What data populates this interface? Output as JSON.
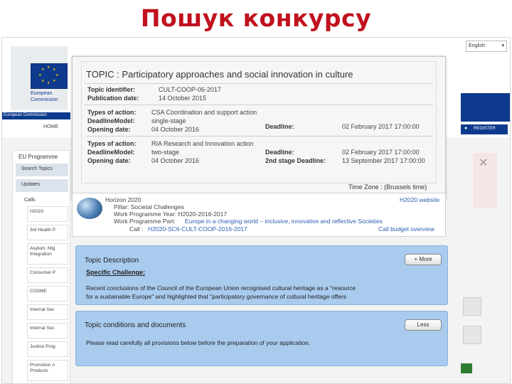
{
  "slide_title": "Пошук конкурсу",
  "portal": {
    "org_name_1": "European",
    "org_name_2": "Commission",
    "bar_text": "European Commission",
    "home": "HOME",
    "language": "English",
    "register": "REGISTER"
  },
  "sidebar": {
    "title": "EU Programme",
    "items": [
      "Search Topics",
      "Updates"
    ],
    "calls_label": "Calls",
    "programmes": [
      "H2020",
      "3rd Health P",
      "Asylum, Mig",
      "Integration",
      "Consumer P",
      "COSME",
      "Internal Sec",
      "Internal Sec",
      "Justice Prog",
      "Promotion o",
      "Products"
    ]
  },
  "topic": {
    "heading": "TOPIC : Participatory approaches and social innovation in culture",
    "identifier_label": "Topic identifier:",
    "identifier": "CULT-COOP-06-2017",
    "pubdate_label": "Publication date:",
    "pubdate": "14 October 2015",
    "block1": {
      "type_label": "Types of action:",
      "type": "CSA Coordination and support action",
      "model_label": "DeadlineModel:",
      "model": "single-stage",
      "opening_label": "Opening date:",
      "opening": "04 October 2016",
      "deadline_label": "Deadline:",
      "deadline": "02 February 2017 17:00:00"
    },
    "block2": {
      "type_label": "Types of action:",
      "type": "RIA Research and Innovation action",
      "model_label": "DeadlineModel:",
      "model": "two-stage",
      "opening_label": "Opening date:",
      "opening": "04 October 2016",
      "deadline_label": "Deadline:",
      "deadline": "02 February 2017 17:00:00",
      "deadline2_label": "2nd stage Deadline:",
      "deadline2": "13 September 2017 17:00:00"
    },
    "timezone": "Time Zone : (Brussels time)"
  },
  "info": {
    "programme": "Horizon 2020",
    "pillar": "Pillar: Societal Challenges",
    "wp_year": "Work Programme Year: H2020-2016-2017",
    "wp_part_prefix": "Work Programme Part:",
    "wp_part_link": "Europe in a changing world – inclusive, innovative and reflective Societies",
    "call_prefix": "Call :",
    "call_link": "H2020-SC6-CULT-COOP-2016-2017",
    "website_link": "H2020 website",
    "budget_link": "Call budget overview"
  },
  "description": {
    "title": "Topic Description",
    "more_button": "+ More",
    "subheading": "Specific Challenge:",
    "text_line1": "Recent conclusions of the Council of the European Union recognised cultural heritage as a \"resource",
    "text_line2": "for a sustainable Europe\" and highlighted that \"participatory governance of cultural heritage offers"
  },
  "conditions": {
    "title": "Topic conditions and documents",
    "less_button": "Less",
    "text": "Please read carefully all provisions below before the preparation of your application."
  }
}
